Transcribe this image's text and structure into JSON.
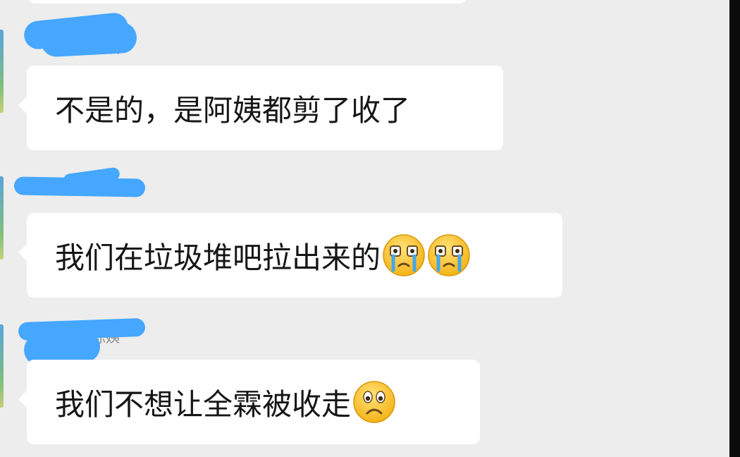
{
  "window": {
    "accent": "#45a7ff",
    "bubble_color": "#ffffff",
    "background": "#ededed"
  },
  "messages": [
    {
      "sender_name": "陈姨",
      "text": "不是的，是阿姨都剪了收了",
      "emojis": []
    },
    {
      "sender_name": "陈姨",
      "text": "我们在垃圾堆吧拉出来的",
      "emojis": [
        "crying-face-icon",
        "crying-face-icon"
      ]
    },
    {
      "sender_name": "陈姨",
      "text": "我们不想让全霖被收走",
      "emojis": [
        "frowning-face-icon"
      ]
    }
  ]
}
